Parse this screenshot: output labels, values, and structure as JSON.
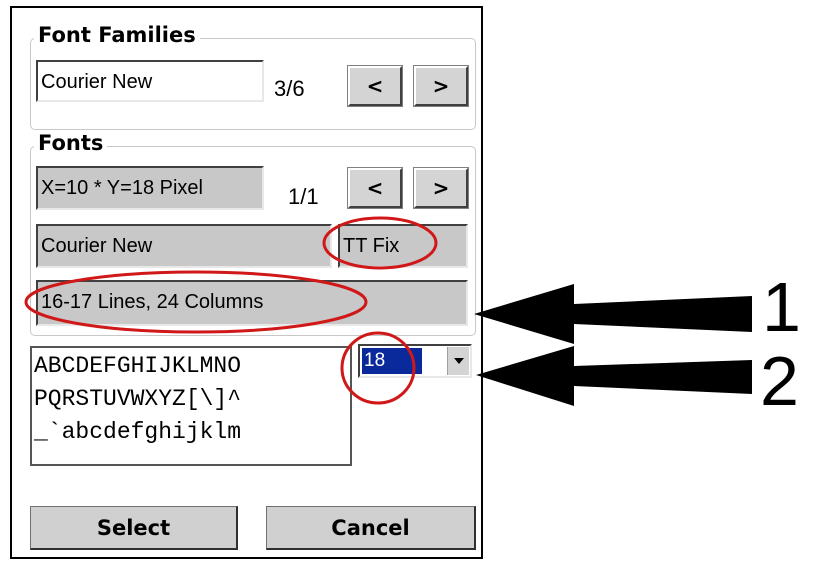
{
  "font_families": {
    "title": "Font Families",
    "value": "Courier New",
    "counter": "3/6",
    "prev_label": "<",
    "next_label": ">"
  },
  "fonts": {
    "title": "Fonts",
    "size_value": "X=10 * Y=18 Pixel",
    "counter": "1/1",
    "prev_label": "<",
    "next_label": ">",
    "font_name": "Courier New",
    "font_type": "TT Fix",
    "dimensions": "16-17 Lines,  24 Columns"
  },
  "preview": {
    "lines": [
      "ABCDEFGHIJKLMNO",
      "PQRSTUVWXYZ[\\]^",
      "_`abcdefghijklm"
    ]
  },
  "size_combo": {
    "value": "18",
    "dropdown_icon": "chevron-down-icon"
  },
  "buttons": {
    "select_label": "Select",
    "cancel_label": "Cancel"
  },
  "callouts": {
    "one": "1",
    "two": "2"
  },
  "colors": {
    "selection_highlight": "#0a2a9c",
    "annotation_red": "#d01818"
  }
}
